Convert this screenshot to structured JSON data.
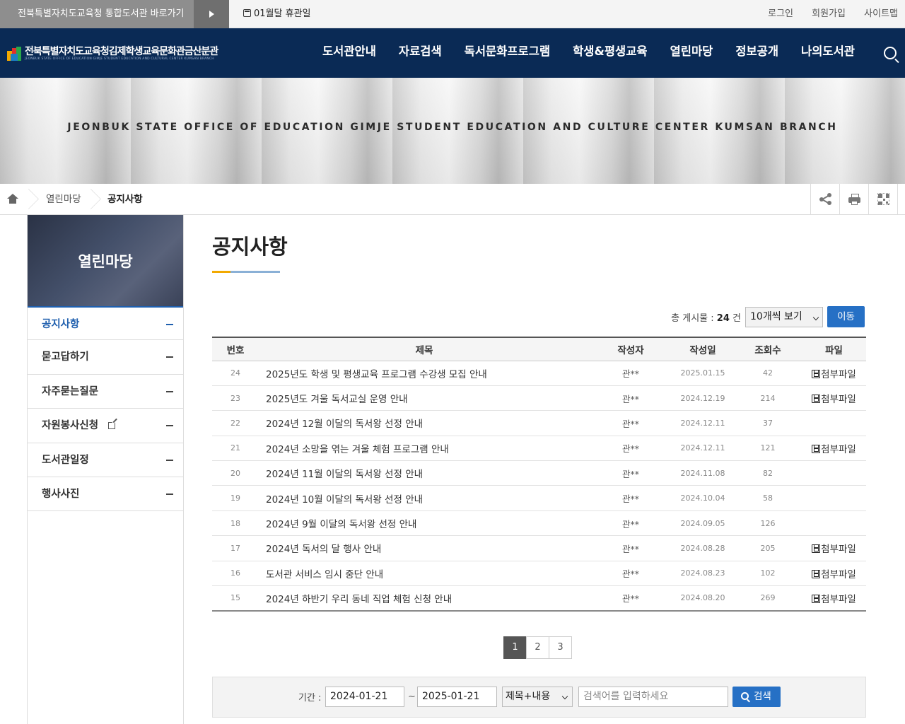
{
  "topbar": {
    "portal_link": "전북특별자치도교육청 통합도서관 바로가기",
    "holiday": "01월달 휴관일",
    "links": [
      "로그인",
      "회원가입",
      "사이트맵"
    ]
  },
  "header": {
    "logo_text": "전북특별자치도교육청김제학생교육문화관금산분관",
    "logo_sub": "JEONBUK STATE OFFICE OF EDUCATION GIMJE STUDENT EDUCATION AND CULTURAL CENTER KUMSAN BRANCH",
    "nav": [
      "도서관안내",
      "자료검색",
      "독서문화프로그램",
      "학생&평생교육",
      "열린마당",
      "정보공개",
      "나의도서관"
    ],
    "accent": "#0a2a55"
  },
  "banner": {
    "caption": "JEONBUK STATE OFFICE OF EDUCATION GIMJE STUDENT EDUCATION AND CULTURE CENTER KUMSAN BRANCH"
  },
  "breadcrumb": {
    "items": [
      "열린마당",
      "공지사항"
    ]
  },
  "sidebar": {
    "title": "열린마당",
    "items": [
      {
        "label": "공지사항",
        "active": true
      },
      {
        "label": "묻고답하기"
      },
      {
        "label": "자주묻는질문"
      },
      {
        "label": "자원봉사신청",
        "external": true
      },
      {
        "label": "도서관일정"
      },
      {
        "label": "행사사진"
      }
    ]
  },
  "main": {
    "title": "공지사항",
    "total_label": "총 게시물 :",
    "total_count": "24",
    "total_unit": "건",
    "per_page": "10개씩 보기",
    "go_button": "이동",
    "columns": [
      "번호",
      "제목",
      "작성자",
      "작성일",
      "조회수",
      "파일"
    ],
    "file_label": "첨부파일",
    "rows": [
      {
        "no": "24",
        "title": "2025년도 학생 및 평생교육 프로그램 수강생 모집 안내",
        "writer": "관**",
        "date": "2025.01.15",
        "views": "42",
        "file": true
      },
      {
        "no": "23",
        "title": "2025년도 겨울 독서교실 운영 안내",
        "writer": "관**",
        "date": "2024.12.19",
        "views": "214",
        "file": true
      },
      {
        "no": "22",
        "title": "2024년 12월 이달의 독서왕 선정 안내",
        "writer": "관**",
        "date": "2024.12.11",
        "views": "37",
        "file": false
      },
      {
        "no": "21",
        "title": "2024년 소망을 엮는 겨울 체험 프로그램 안내",
        "writer": "관**",
        "date": "2024.12.11",
        "views": "121",
        "file": true
      },
      {
        "no": "20",
        "title": "2024년 11월 이달의 독서왕 선정 안내",
        "writer": "관**",
        "date": "2024.11.08",
        "views": "82",
        "file": false
      },
      {
        "no": "19",
        "title": "2024년 10월 이달의 독서왕 선정 안내",
        "writer": "관**",
        "date": "2024.10.04",
        "views": "58",
        "file": false
      },
      {
        "no": "18",
        "title": "2024년 9월 이달의 독서왕 선정 안내",
        "writer": "관**",
        "date": "2024.09.05",
        "views": "126",
        "file": false
      },
      {
        "no": "17",
        "title": "2024년 독서의 달 행사 안내",
        "writer": "관**",
        "date": "2024.08.28",
        "views": "205",
        "file": true
      },
      {
        "no": "16",
        "title": "도서관 서비스 임시 중단 안내",
        "writer": "관**",
        "date": "2024.08.23",
        "views": "102",
        "file": true
      },
      {
        "no": "15",
        "title": "2024년 하반기 우리 동네 직업 체험 신청 안내",
        "writer": "관**",
        "date": "2024.08.20",
        "views": "269",
        "file": true
      }
    ],
    "pages": [
      "1",
      "2",
      "3"
    ],
    "current_page": "1"
  },
  "search": {
    "period_label": "기간 :",
    "start_date": "2024-01-21",
    "tilde": "~",
    "end_date": "2025-01-21",
    "field": "제목+내용",
    "placeholder": "검색어를 입력하세요",
    "button": "검색",
    "accent": "#2670c5"
  }
}
